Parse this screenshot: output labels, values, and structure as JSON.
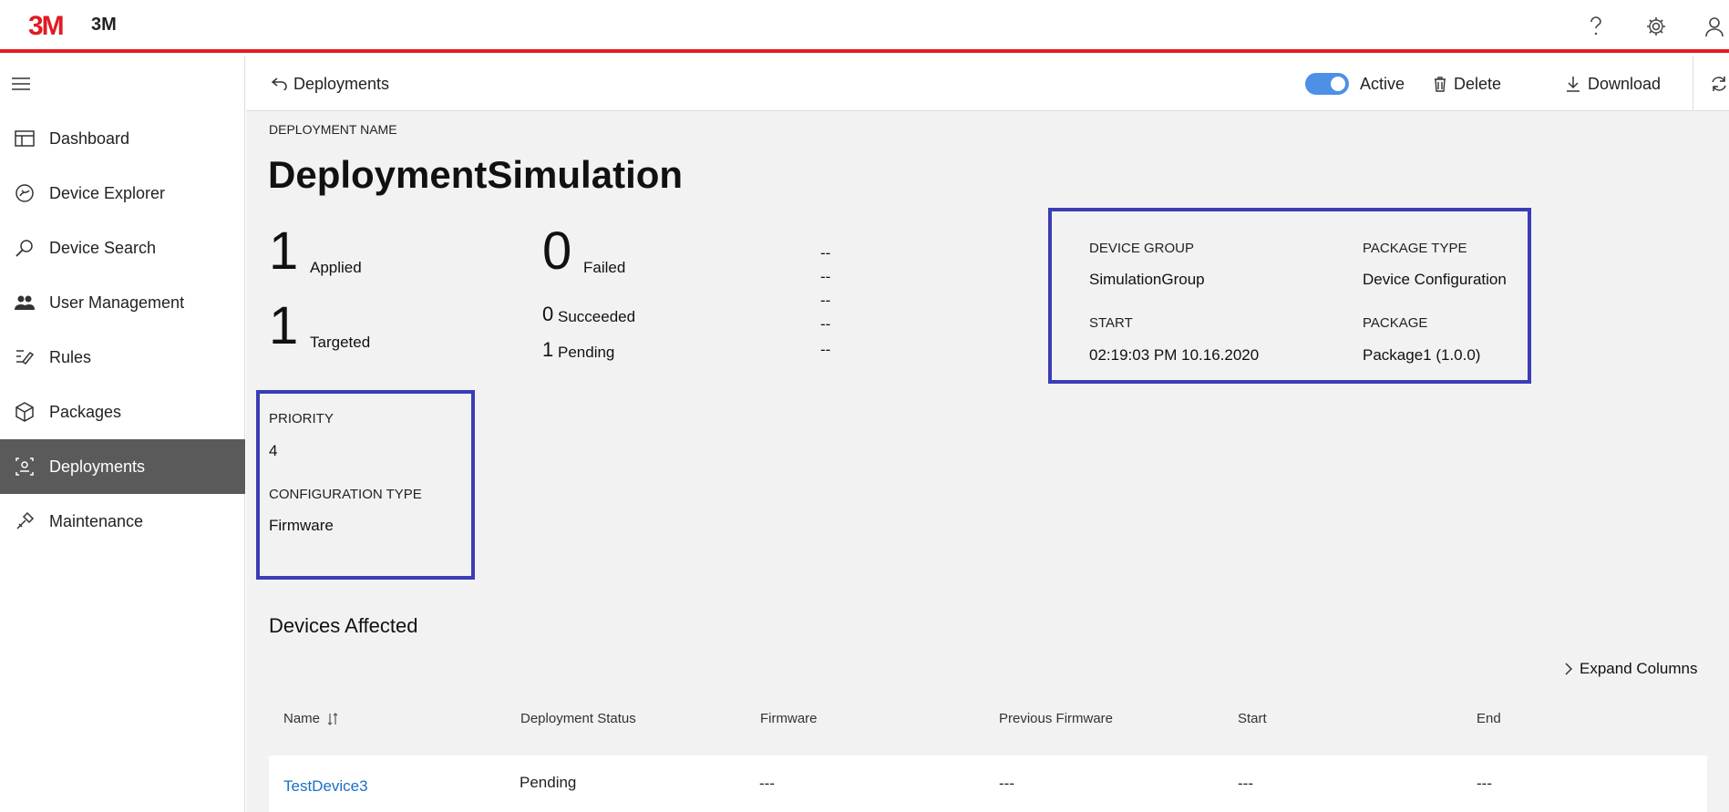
{
  "header": {
    "logo": "3M",
    "brand": "3M",
    "icons": [
      "help-icon",
      "gear-icon",
      "user-icon"
    ],
    "accent": "#e11b22"
  },
  "sidebar": {
    "items": [
      {
        "label": "Dashboard",
        "icon": "dashboard-icon",
        "active": false
      },
      {
        "label": "Device Explorer",
        "icon": "device-explorer-icon",
        "active": false
      },
      {
        "label": "Device Search",
        "icon": "search-icon",
        "active": false
      },
      {
        "label": "User Management",
        "icon": "users-icon",
        "active": false
      },
      {
        "label": "Rules",
        "icon": "rules-icon",
        "active": false
      },
      {
        "label": "Packages",
        "icon": "package-icon",
        "active": false
      },
      {
        "label": "Deployments",
        "icon": "deployments-icon",
        "active": true
      },
      {
        "label": "Maintenance",
        "icon": "maintenance-icon",
        "active": false
      }
    ]
  },
  "toolbar": {
    "back_label": "Deployments",
    "active_label": "Active",
    "active_on": true,
    "delete_label": "Delete",
    "download_label": "Download"
  },
  "deployment": {
    "name_label": "DEPLOYMENT NAME",
    "name": "DeploymentSimulation",
    "applied_count": "1",
    "applied_label": "Applied",
    "targeted_count": "1",
    "targeted_label": "Targeted",
    "failed_count": "0",
    "failed_label": "Failed",
    "succeeded_count": "0",
    "succeeded_label": "Succeeded",
    "pending_count": "1",
    "pending_label": "Pending",
    "dashes": [
      "--",
      "--",
      "--",
      "--",
      "--"
    ]
  },
  "details": {
    "device_group_label": "DEVICE GROUP",
    "device_group": "SimulationGroup",
    "package_type_label": "PACKAGE TYPE",
    "package_type": "Device Configuration",
    "start_label": "START",
    "start": "02:19:03 PM 10.16.2020",
    "package_label": "PACKAGE",
    "package": "Package1 (1.0.0)",
    "priority_label": "PRIORITY",
    "priority": "4",
    "config_type_label": "CONFIGURATION TYPE",
    "config_type": "Firmware",
    "box_color": "#3b3db5"
  },
  "devices": {
    "title": "Devices Affected",
    "expand_label": "Expand Columns",
    "columns": [
      "Name",
      "Deployment Status",
      "Firmware",
      "Previous Firmware",
      "Start",
      "End"
    ],
    "rows": [
      {
        "name": "TestDevice3",
        "status": "Pending",
        "firmware": "---",
        "previous_firmware": "---",
        "start": "---",
        "end": "---"
      }
    ]
  }
}
